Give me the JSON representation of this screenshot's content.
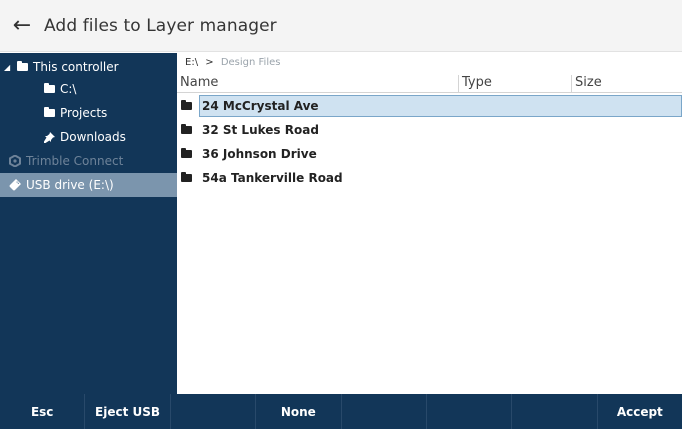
{
  "header": {
    "back_glyph": "←",
    "title": "Add files to Layer manager"
  },
  "sidebar": {
    "items": [
      {
        "label": "This controller",
        "icon": "folder-icon",
        "expanded": true
      },
      {
        "label": "C:\\",
        "icon": "folder-icon"
      },
      {
        "label": "Projects",
        "icon": "folder-icon"
      },
      {
        "label": "Downloads",
        "icon": "pin-icon"
      },
      {
        "label": "Trimble Connect",
        "icon": "trimble-connect-icon",
        "disabled": true
      },
      {
        "label": "USB drive (E:\\)",
        "icon": "usb-icon",
        "selected": true
      }
    ]
  },
  "breadcrumb": {
    "root": "E:\\",
    "separator": ">",
    "current": "Design Files"
  },
  "columns": {
    "name": "Name",
    "type": "Type",
    "size": "Size"
  },
  "files": [
    {
      "name": "24 McCrystal Ave",
      "selected": true
    },
    {
      "name": "32 St Lukes Road"
    },
    {
      "name": "36 Johnson Drive"
    },
    {
      "name": "54a Tankerville Road"
    }
  ],
  "footer": {
    "esc": "Esc",
    "eject": "Eject USB",
    "none": "None",
    "accept": "Accept"
  },
  "colors": {
    "navy": "#123658",
    "selected_sidebar": "#7b95ad",
    "selected_row": "#cfe2f1"
  }
}
